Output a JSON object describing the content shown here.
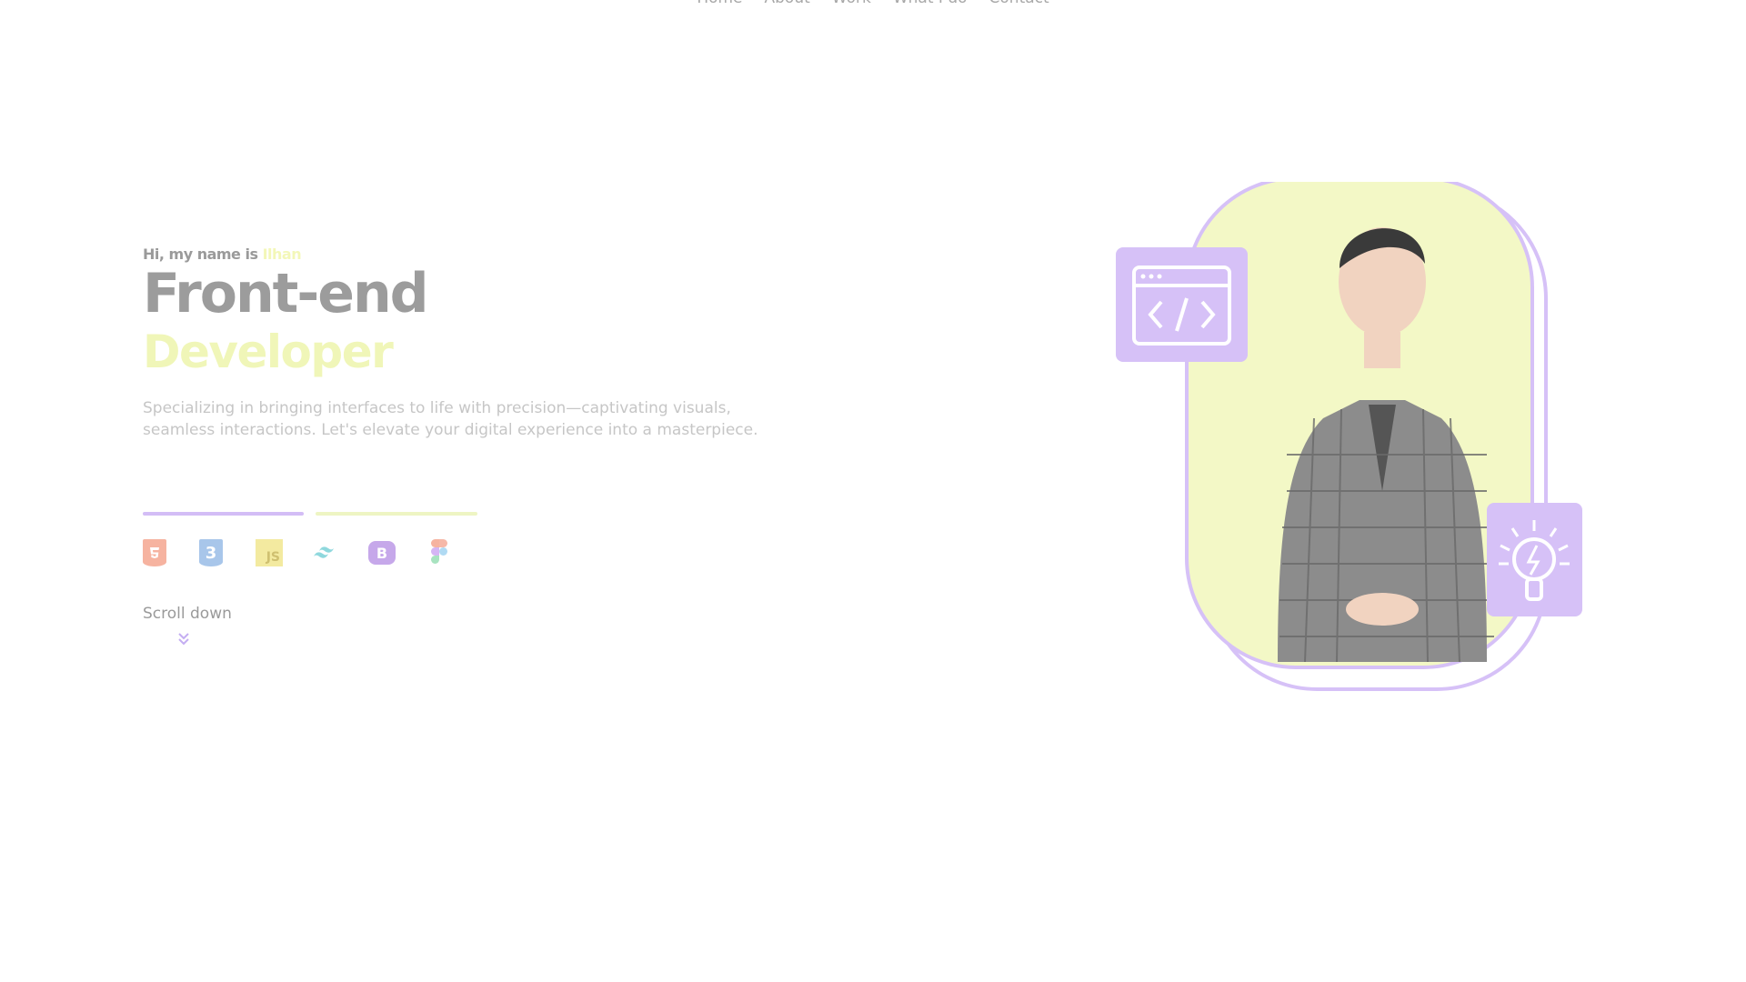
{
  "nav": {
    "items": [
      "Home",
      "About",
      "Work",
      "What I do",
      "Contact"
    ]
  },
  "hero": {
    "greeting_prefix": "Hi, my name is",
    "name": "Ilhan",
    "title": "Front-end",
    "subtitle": "Developer",
    "description": "Specializing in bringing interfaces to life with precision—captivating visuals, seamless interactions. Let's elevate your digital experience into a masterpiece."
  },
  "tech_stack": [
    {
      "name": "HTML5",
      "icon": "html5-icon"
    },
    {
      "name": "CSS3",
      "icon": "css3-icon"
    },
    {
      "name": "JavaScript",
      "icon": "javascript-icon"
    },
    {
      "name": "Tailwind CSS",
      "icon": "tailwind-icon"
    },
    {
      "name": "Bootstrap",
      "icon": "bootstrap-icon"
    },
    {
      "name": "Figma",
      "icon": "figma-icon"
    }
  ],
  "tech_labels": {
    "css": "3",
    "js": "JS",
    "bs": "B"
  },
  "scroll": {
    "label": "Scroll down",
    "icon": "double-chevron-down-icon"
  },
  "colors": {
    "accent_purple": "#d3bdf6",
    "accent_lime": "#f3f8c6",
    "text_gray": "#9c9c9c"
  }
}
